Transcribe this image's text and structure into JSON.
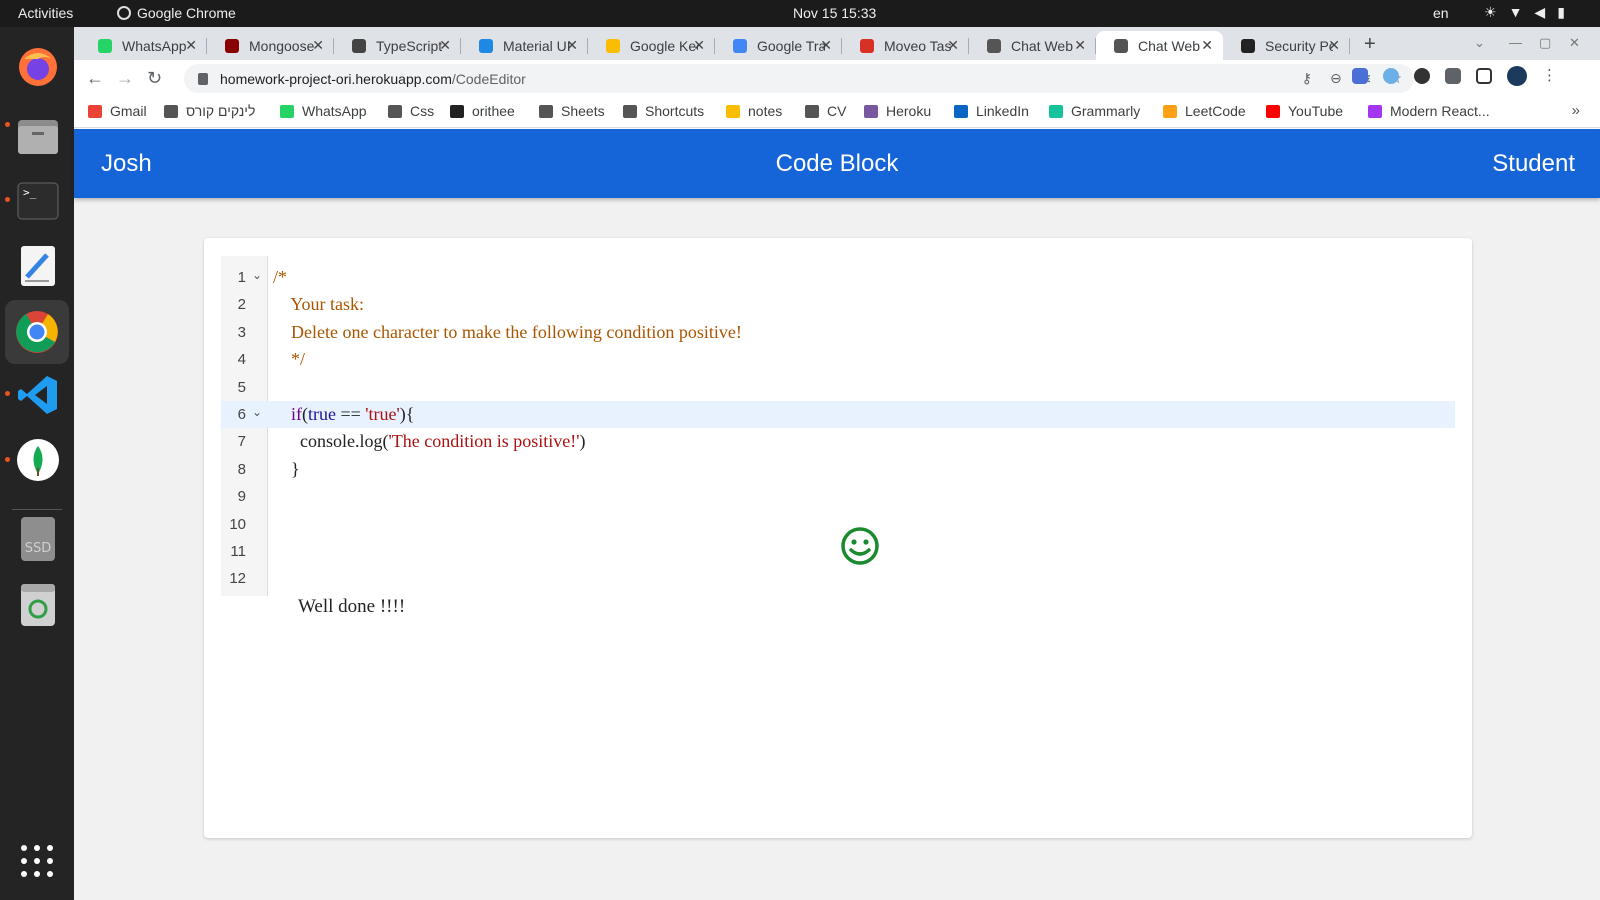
{
  "topbar": {
    "activities": "Activities",
    "app_name": "Google Chrome",
    "clock": "Nov 15  15:33",
    "lang": "en",
    "tray_icons": [
      "brightness-icon",
      "wifi-icon",
      "volume-icon",
      "battery-icon"
    ]
  },
  "dock": {
    "apps": [
      "firefox-icon",
      "files-icon",
      "terminal-icon",
      "text-editor-icon",
      "chrome-icon",
      "vscode-icon",
      "mongodb-compass-icon",
      "ssd-drive-icon",
      "trash-icon",
      "show-apps-icon"
    ],
    "ssd_label": "SSD"
  },
  "tabs": [
    {
      "label": "WhatsApp",
      "color": "#25d366"
    },
    {
      "label": "Mongoose",
      "color": "#880000"
    },
    {
      "label": "TypeScript",
      "color": "#444444"
    },
    {
      "label": "Material UI",
      "color": "#1e88e5"
    },
    {
      "label": "Google Keep",
      "color": "#fbbc04"
    },
    {
      "label": "Google Translate",
      "color": "#4285f4"
    },
    {
      "label": "Moveo Task",
      "color": "#d93025"
    },
    {
      "label": "Chat Web",
      "color": "#555555"
    },
    {
      "label": "Chat Web",
      "color": "#555555",
      "active": true
    },
    {
      "label": "Security Policy",
      "color": "#222222"
    }
  ],
  "address": {
    "host": "homework-project-ori.herokuapp.com",
    "path": "/CodeEditor"
  },
  "bookmarks": [
    {
      "label": "Gmail",
      "color": "#ea4335"
    },
    {
      "label": "לינקים קורס",
      "color": "#555555"
    },
    {
      "label": "WhatsApp",
      "color": "#25d366"
    },
    {
      "label": "Css",
      "color": "#555555"
    },
    {
      "label": "orithee",
      "color": "#222222"
    },
    {
      "label": "Sheets",
      "color": "#555555"
    },
    {
      "label": "Shortcuts",
      "color": "#555555"
    },
    {
      "label": "notes",
      "color": "#fbbc04"
    },
    {
      "label": "CV",
      "color": "#555555"
    },
    {
      "label": "Heroku",
      "color": "#79589f"
    },
    {
      "label": "LinkedIn",
      "color": "#0a66c2"
    },
    {
      "label": "Grammarly",
      "color": "#15c39a"
    },
    {
      "label": "LeetCode",
      "color": "#ffa116"
    },
    {
      "label": "YouTube",
      "color": "#ff0000"
    },
    {
      "label": "Modern React...",
      "color": "#a435f0"
    }
  ],
  "app": {
    "user_name": "Josh",
    "title": "Code Block",
    "role": "Student",
    "accent": "#1565d8",
    "success_message": "Well done !!!!",
    "smiley_color": "#1a8a2e"
  },
  "editor": {
    "lines": [
      {
        "n": "1",
        "fold": true,
        "tokens": [
          {
            "t": "/*",
            "c": "comment"
          }
        ]
      },
      {
        "n": "2",
        "tokens": [
          {
            "t": "    Your task:",
            "c": "comment"
          }
        ]
      },
      {
        "n": "3",
        "tokens": [
          {
            "t": "    Delete one character to make the following condition positive!",
            "c": "comment"
          }
        ]
      },
      {
        "n": "4",
        "tokens": [
          {
            "t": "    */",
            "c": "comment"
          }
        ]
      },
      {
        "n": "5",
        "tokens": []
      },
      {
        "n": "6",
        "fold": true,
        "highlight": true,
        "tokens": [
          {
            "t": "    ",
            "c": "plain"
          },
          {
            "t": "if",
            "c": "kw"
          },
          {
            "t": "(",
            "c": "plain"
          },
          {
            "t": "true",
            "c": "atom"
          },
          {
            "t": " == ",
            "c": "plain"
          },
          {
            "t": "'true'",
            "c": "str"
          },
          {
            "t": "){",
            "c": "plain"
          }
        ]
      },
      {
        "n": "7",
        "tokens": [
          {
            "t": "      console.log(",
            "c": "plain"
          },
          {
            "t": "'The condition is positive!'",
            "c": "str"
          },
          {
            "t": ")",
            "c": "plain"
          }
        ]
      },
      {
        "n": "8",
        "tokens": [
          {
            "t": "    }",
            "c": "plain"
          }
        ]
      },
      {
        "n": "9",
        "tokens": []
      },
      {
        "n": "10",
        "tokens": []
      },
      {
        "n": "11",
        "tokens": []
      },
      {
        "n": "12",
        "tokens": []
      }
    ]
  }
}
